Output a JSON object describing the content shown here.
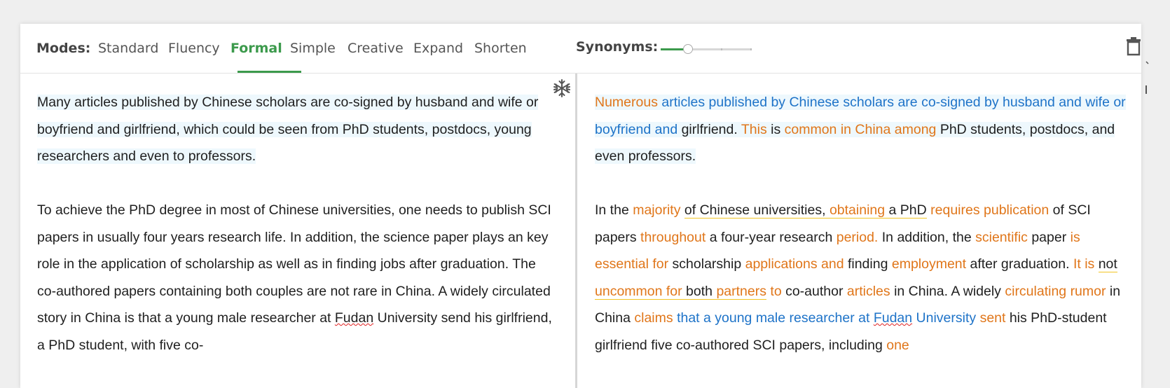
{
  "toolbar": {
    "modes_label": "Modes:",
    "modes": [
      {
        "label": "Standard",
        "active": false
      },
      {
        "label": "Fluency",
        "active": false
      },
      {
        "label": "Formal",
        "active": true
      },
      {
        "label": "Simple",
        "active": false
      },
      {
        "label": "Creative",
        "active": false
      },
      {
        "label": "Expand",
        "active": false
      },
      {
        "label": "Shorten",
        "active": false
      }
    ],
    "synonyms_label": "Synonyms:",
    "synonyms_level": 0.3,
    "delete_icon": "trash-icon",
    "accent_color": "#3c9a4c"
  },
  "freeze_icon": "snowflake-icon",
  "input": {
    "p1": "Many articles published by Chinese scholars are co-signed by husband and wife or boyfriend and girlfriend, which could be seen from PhD students, postdocs, young researchers and even to professors.",
    "p2": {
      "a": "To achieve the PhD degree in most of Chinese universities, one needs to publish SCI papers in usually four years research life. In addition, the science paper plays an key role in the application of scholarship as well as in finding jobs after graduation. The co-authored papers containing both couples are not rare in China. A widely circulated story in China is that a young male researcher at ",
      "fudan": "Fudan",
      "b": " University send his girlfriend, a PhD student, with five co-"
    }
  },
  "output": {
    "p1": [
      {
        "t": "Numerous",
        "c": "orange"
      },
      {
        "t": " ",
        "c": ""
      },
      {
        "t": "articles published by Chinese scholars are co-signed by husband and wife or boyfriend and",
        "c": "blue"
      },
      {
        "t": " girlfriend. ",
        "c": ""
      },
      {
        "t": "This",
        "c": "orange"
      },
      {
        "t": " is ",
        "c": ""
      },
      {
        "t": "common in China among",
        "c": "orange"
      },
      {
        "t": " PhD students, postdocs, and even professors.",
        "c": ""
      }
    ],
    "p2": [
      {
        "t": "In the ",
        "c": ""
      },
      {
        "t": "majority",
        "c": "orange"
      },
      {
        "t": " ",
        "c": ""
      },
      {
        "t": "of Chinese universities, ",
        "c": "",
        "u": true
      },
      {
        "t": "obtaining",
        "c": "orange",
        "u": true
      },
      {
        "t": " a PhD",
        "c": "",
        "u": true
      },
      {
        "t": " ",
        "c": ""
      },
      {
        "t": "requires publication",
        "c": "orange"
      },
      {
        "t": " of SCI papers ",
        "c": ""
      },
      {
        "t": "throughout",
        "c": "orange"
      },
      {
        "t": " a four-year research ",
        "c": ""
      },
      {
        "t": "period.",
        "c": "orange"
      },
      {
        "t": " In addition, the ",
        "c": ""
      },
      {
        "t": "scientific",
        "c": "orange"
      },
      {
        "t": " paper ",
        "c": ""
      },
      {
        "t": "is essential for",
        "c": "orange"
      },
      {
        "t": " scholarship ",
        "c": ""
      },
      {
        "t": "applications and",
        "c": "orange"
      },
      {
        "t": " finding ",
        "c": ""
      },
      {
        "t": "employment",
        "c": "orange"
      },
      {
        "t": " after graduation. ",
        "c": ""
      },
      {
        "t": "It is",
        "c": "orange"
      },
      {
        "t": " ",
        "c": ""
      },
      {
        "t": "not ",
        "c": "",
        "u": true
      },
      {
        "t": "uncommon for",
        "c": "orange",
        "u": true
      },
      {
        "t": " both ",
        "c": "",
        "u": true
      },
      {
        "t": "partners",
        "c": "orange",
        "u": true
      },
      {
        "t": " ",
        "c": ""
      },
      {
        "t": "to",
        "c": "orange"
      },
      {
        "t": " co-author ",
        "c": ""
      },
      {
        "t": "articles",
        "c": "orange"
      },
      {
        "t": " in China. A widely ",
        "c": ""
      },
      {
        "t": "circulating rumor",
        "c": "orange"
      },
      {
        "t": " in China ",
        "c": ""
      },
      {
        "t": "claims",
        "c": "orange"
      },
      {
        "t": " ",
        "c": ""
      },
      {
        "t": "that a young male researcher at ",
        "c": "blue"
      },
      {
        "t": "Fudan",
        "c": "blue",
        "s": true
      },
      {
        "t": " University",
        "c": "blue"
      },
      {
        "t": " ",
        "c": ""
      },
      {
        "t": "sent",
        "c": "orange"
      },
      {
        "t": " his PhD-student girlfriend five co-authored SCI papers, including ",
        "c": ""
      },
      {
        "t": "one",
        "c": "orange"
      }
    ]
  }
}
